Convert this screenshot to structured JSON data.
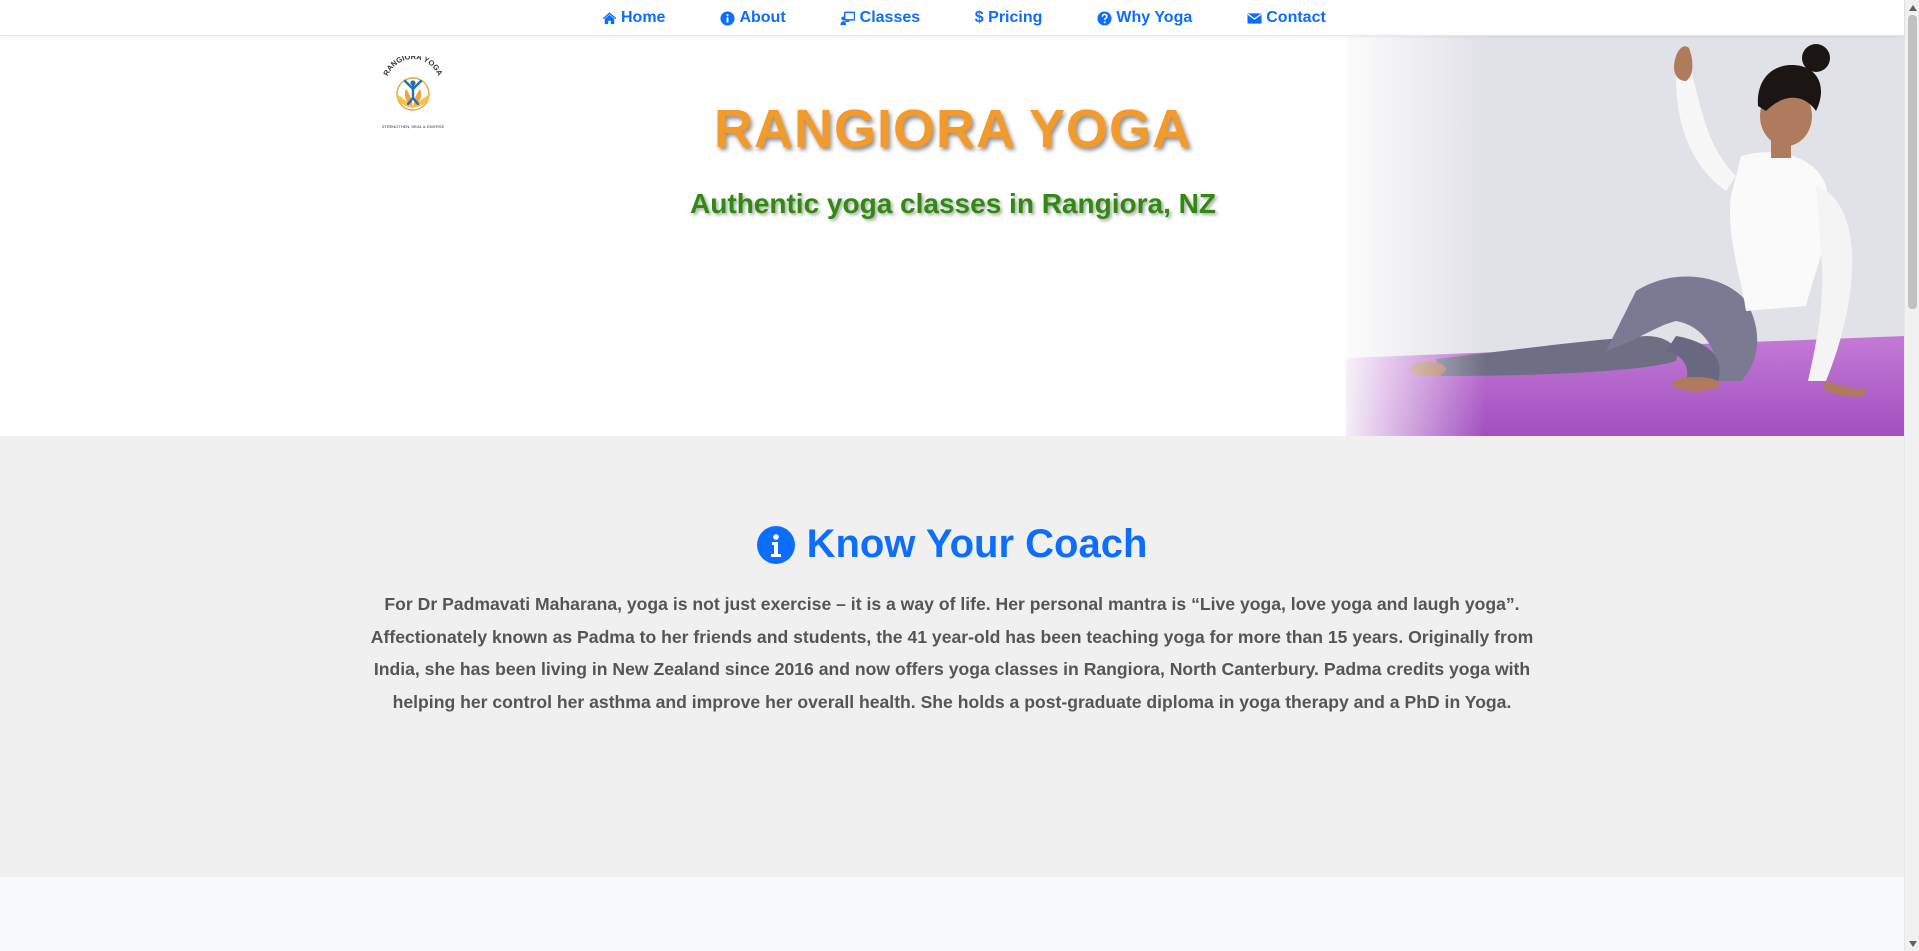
{
  "nav": {
    "items": [
      {
        "label": "Home",
        "icon": "home-icon"
      },
      {
        "label": "About",
        "icon": "info-circle-icon"
      },
      {
        "label": "Classes",
        "icon": "chalkboard-teacher-icon"
      },
      {
        "label": "Pricing",
        "icon": "dollar-icon"
      },
      {
        "label": "Why Yoga",
        "icon": "question-circle-icon"
      },
      {
        "label": "Contact",
        "icon": "envelope-icon"
      }
    ]
  },
  "hero": {
    "logo": {
      "text_top": "RANGIORA YOGA",
      "tagline": "STRENGTHEN, HEAL & DIVERSE"
    },
    "title": "RANGIORA YOGA",
    "subtitle": "Authentic yoga classes in Rangiora, NZ"
  },
  "coach": {
    "icon": "info-circle-icon",
    "heading": "Know Your Coach",
    "text": "For Dr Padmavati Maharana, yoga is not just exercise – it is a way of life. Her personal mantra is “Live yoga, love yoga and laugh yoga”. Affectionately known as Padma to her friends and students, the 41 year-old has been teaching yoga for more than 15 years. Originally from India, she has been living in New Zealand since 2016 and now offers yoga classes in Rangiora, North Canterbury. Padma credits yoga with helping her control her asthma and improve her overall health. She holds a post-graduate diploma in yoga therapy and a PhD in Yoga."
  },
  "colors": {
    "accent": "#0d6efd",
    "title_orange": "#f39a2b",
    "subtitle_green": "#2f8a0f",
    "section_bg": "#f0f0f0",
    "body_text": "#555555"
  }
}
